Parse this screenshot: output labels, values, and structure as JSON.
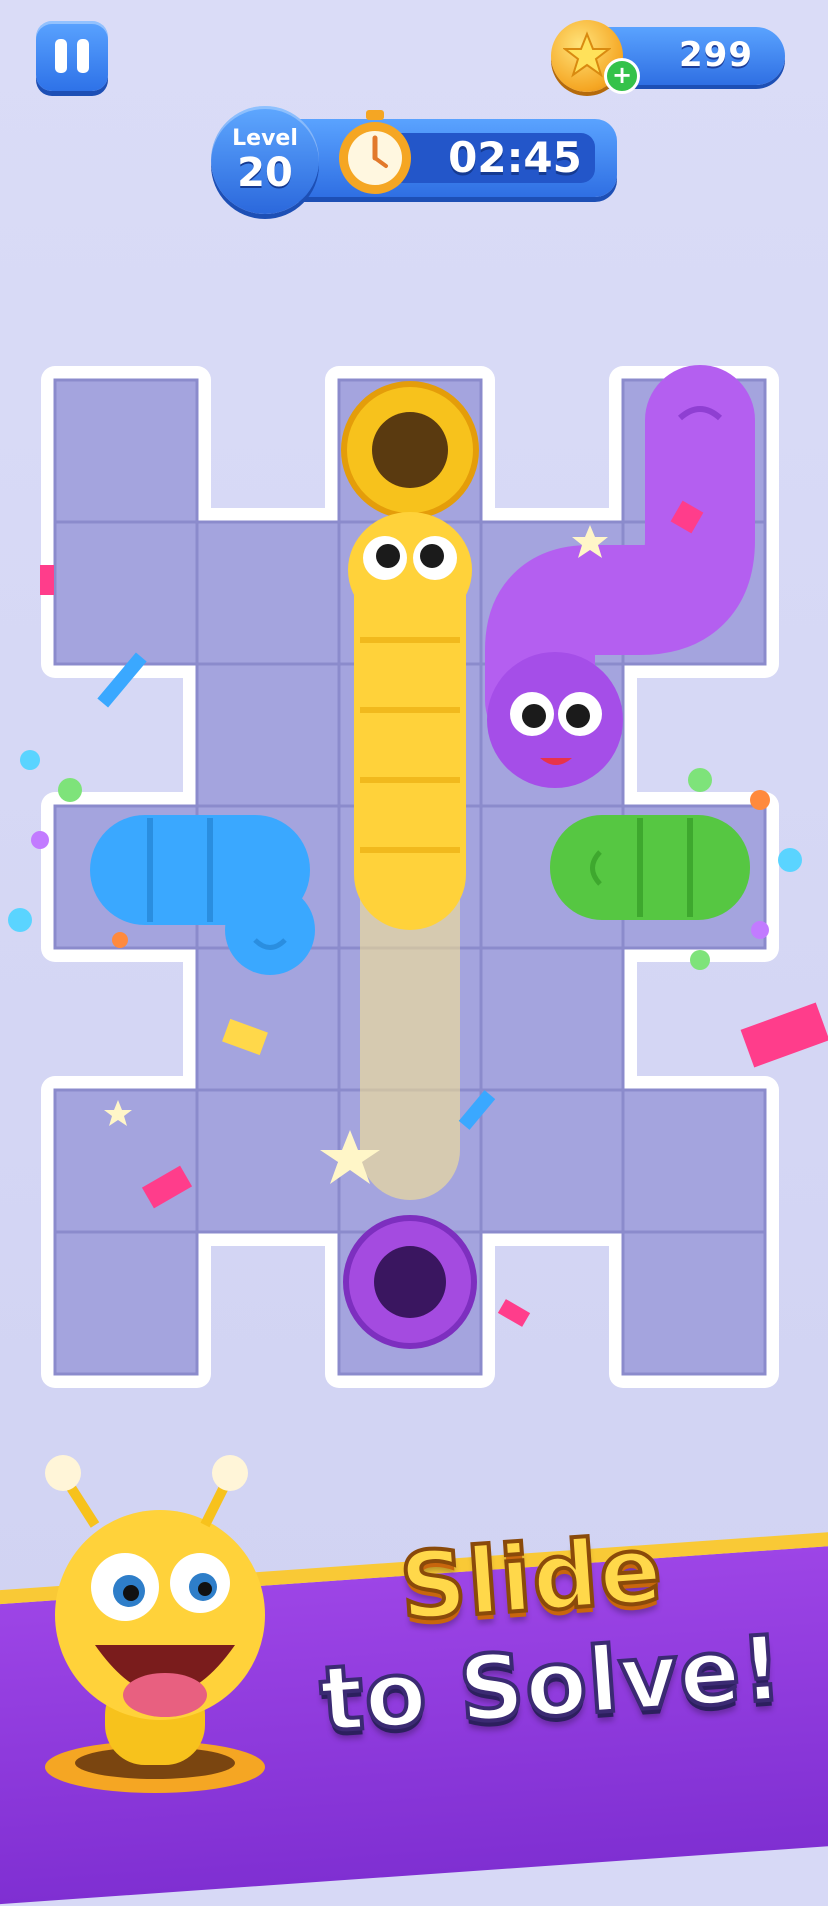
{
  "hud": {
    "pause_icon": "pause-icon",
    "coins": "299",
    "coin_icon": "star-coin-icon",
    "add_coins_icon": "plus-icon",
    "level_label": "Level",
    "level_number": "20",
    "timer_icon": "stopwatch-icon",
    "timer": "02:45"
  },
  "colors": {
    "background": "#d7d9f6",
    "board": "#a4a4de",
    "hud_blue": "#2f6fe3",
    "yellow_worm": "#ffd23a",
    "purple_worm": "#b45ff0",
    "blue_worm": "#3aa8ff",
    "green_worm": "#56c742",
    "banner": "#8a39dc"
  },
  "board": {
    "worms": [
      "yellow-worm",
      "purple-worm",
      "blue-worm",
      "green-worm"
    ],
    "holes": [
      "yellow-hole",
      "purple-hole"
    ]
  },
  "banner": {
    "line1": "Slide",
    "line2": "to Solve!"
  }
}
